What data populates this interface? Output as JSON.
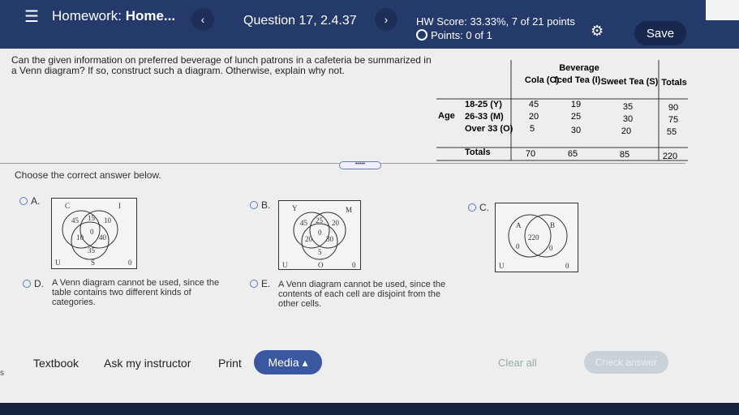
{
  "header": {
    "homework_label": "Homework:",
    "homework_name": "Home...",
    "question": "Question 17, 2.4.37",
    "hw_score": "HW Score: 33.33%, 7 of 21 points",
    "points": "Points: 0 of 1",
    "save": "Save",
    "prev": "‹",
    "next": "›"
  },
  "question": {
    "text": "Can the given information on preferred beverage of lunch patrons in a cafeteria be summarized in a Venn diagram? If so, construct such a diagram. Otherwise, explain why not.",
    "choose": "Choose the correct answer below."
  },
  "table": {
    "group_header": "Beverage",
    "columns": [
      "Cola (C)",
      "Iced Tea (I)",
      "Sweet Tea (S)",
      "Totals"
    ],
    "row_group": "Age",
    "rows": [
      {
        "label": "18-25 (Y)",
        "values": [
          "45",
          "19",
          "35",
          "90"
        ]
      },
      {
        "label": "26-33 (M)",
        "values": [
          "20",
          "25",
          "30",
          "75"
        ]
      },
      {
        "label": "Over 33 (O)",
        "values": [
          "5",
          "30",
          "20",
          "55"
        ]
      },
      {
        "label": "Totals",
        "values": [
          "70",
          "65",
          "85",
          "220"
        ]
      }
    ]
  },
  "options": {
    "a": {
      "letter": "A.",
      "sets": [
        "C",
        "I"
      ],
      "u": "U",
      "s": "S",
      "vals": [
        "45",
        "15",
        "10",
        "0",
        "10",
        "40",
        "35",
        "0"
      ]
    },
    "b": {
      "letter": "B.",
      "sets": [
        "Y",
        "M"
      ],
      "u": "U",
      "o": "O",
      "vals": [
        "45",
        "25",
        "20",
        "0",
        "20",
        "30",
        "5",
        "0"
      ]
    },
    "c": {
      "letter": "C.",
      "sets": [
        "A",
        "B"
      ],
      "u": "U",
      "vals": [
        "220",
        "0",
        "0",
        "0"
      ]
    },
    "d": {
      "letter": "D.",
      "text": "A Venn diagram cannot be used, since the table contains two different kinds of categories."
    },
    "e": {
      "letter": "E.",
      "text": "A Venn diagram cannot be used, since the contents of each cell are disjoint from the other cells."
    }
  },
  "footer": {
    "textbook": "Textbook",
    "ask": "Ask my instructor",
    "print": "Print",
    "media": "Media ▴",
    "clear": "Clear all",
    "check": "Check answer"
  },
  "stray": "s"
}
